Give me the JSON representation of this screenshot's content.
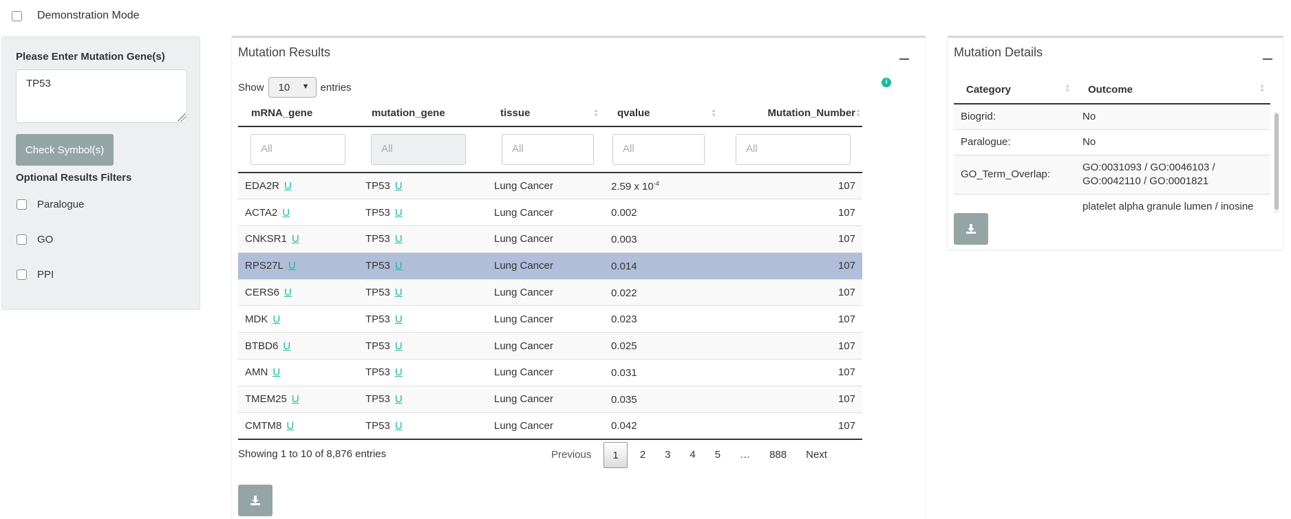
{
  "demo_mode": {
    "label": "Demonstration Mode",
    "checked": false
  },
  "sidebar": {
    "gene_label": "Please Enter Mutation Gene(s)",
    "gene_value": "TP53",
    "check_button": "Check Symbol(s)",
    "filters_label": "Optional Results Filters",
    "filters": [
      {
        "label": "Paralogue",
        "checked": false
      },
      {
        "label": "GO",
        "checked": false
      },
      {
        "label": "PPI",
        "checked": false
      }
    ]
  },
  "results": {
    "title": "Mutation Results",
    "show_label": "Show",
    "entries_label": "entries",
    "page_length": "10",
    "columns": [
      "mRNA_gene",
      "mutation_gene",
      "tissue",
      "qvalue",
      "Mutation_Number"
    ],
    "filter_placeholder": "All",
    "link_text": "U",
    "rows": [
      {
        "mrna": "EDA2R",
        "mutation": "TP53",
        "tissue": "Lung Cancer",
        "qvalue": "2.59 x 10",
        "qexp": "-4",
        "number": "107"
      },
      {
        "mrna": "ACTA2",
        "mutation": "TP53",
        "tissue": "Lung Cancer",
        "qvalue": "0.002",
        "qexp": "",
        "number": "107"
      },
      {
        "mrna": "CNKSR1",
        "mutation": "TP53",
        "tissue": "Lung Cancer",
        "qvalue": "0.003",
        "qexp": "",
        "number": "107"
      },
      {
        "mrna": "RPS27L",
        "mutation": "TP53",
        "tissue": "Lung Cancer",
        "qvalue": "0.014",
        "qexp": "",
        "number": "107",
        "selected": true
      },
      {
        "mrna": "CERS6",
        "mutation": "TP53",
        "tissue": "Lung Cancer",
        "qvalue": "0.022",
        "qexp": "",
        "number": "107"
      },
      {
        "mrna": "MDK",
        "mutation": "TP53",
        "tissue": "Lung Cancer",
        "qvalue": "0.023",
        "qexp": "",
        "number": "107"
      },
      {
        "mrna": "BTBD6",
        "mutation": "TP53",
        "tissue": "Lung Cancer",
        "qvalue": "0.025",
        "qexp": "",
        "number": "107"
      },
      {
        "mrna": "AMN",
        "mutation": "TP53",
        "tissue": "Lung Cancer",
        "qvalue": "0.031",
        "qexp": "",
        "number": "107"
      },
      {
        "mrna": "TMEM25",
        "mutation": "TP53",
        "tissue": "Lung Cancer",
        "qvalue": "0.035",
        "qexp": "",
        "number": "107"
      },
      {
        "mrna": "CMTM8",
        "mutation": "TP53",
        "tissue": "Lung Cancer",
        "qvalue": "0.042",
        "qexp": "",
        "number": "107"
      }
    ],
    "info": "Showing 1 to 10 of 8,876 entries",
    "pager": {
      "previous": "Previous",
      "pages": [
        "1",
        "2",
        "3",
        "4",
        "5"
      ],
      "ellipsis": "…",
      "last": "888",
      "next": "Next",
      "current": "1"
    }
  },
  "details": {
    "title": "Mutation Details",
    "columns": [
      "Category",
      "Outcome"
    ],
    "rows": [
      {
        "category": "Biogrid:",
        "outcome": "No"
      },
      {
        "category": "Paralogue:",
        "outcome": "No"
      },
      {
        "category": "GO_Term_Overlap:",
        "outcome": "GO:0031093 / GO:0046103 / GO:0042110 / GO:0001821"
      },
      {
        "category": "",
        "outcome": "platelet alpha granule lumen / inosine"
      }
    ]
  },
  "colors": {
    "accent": "#18bc9c",
    "button": "#95a5a6",
    "selected_row": "#b0bed9",
    "sidebar_bg": "#ecf0f1"
  }
}
